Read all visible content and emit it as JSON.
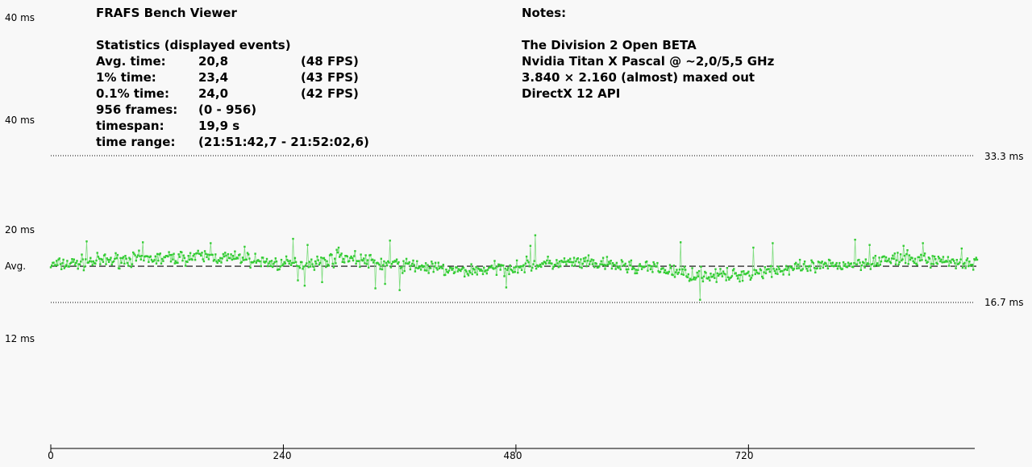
{
  "header": {
    "title": "FRAFS Bench Viewer",
    "stats_heading": "Statistics (displayed events)",
    "rows": [
      {
        "label": "Avg. time:",
        "value": "20,8",
        "extra": "(48 FPS)"
      },
      {
        "label": "1% time:",
        "value": "23,4",
        "extra": "(43 FPS)"
      },
      {
        "label": "0.1% time:",
        "value": "24,0",
        "extra": "(42 FPS)"
      },
      {
        "label": "956 frames:",
        "value": "(0 - 956)",
        "extra": ""
      },
      {
        "label": "timespan:",
        "value": "19,9 s",
        "extra": ""
      },
      {
        "label": "time range:",
        "value": "(21:51:42,7 - 21:52:02,6)",
        "extra": ""
      }
    ]
  },
  "notes": {
    "heading": "Notes:",
    "lines": [
      "The Division 2 Open BETA",
      "Nvidia Titan X Pascal @ ~2,0/5,5 GHz",
      "3.840 × 2.160 (almost) maxed out",
      "DirectX 12 API"
    ]
  },
  "axis_left": {
    "top": "40 ms",
    "upper": "40 ms",
    "mid": "20 ms",
    "avg": "Avg.",
    "low": "12 ms"
  },
  "axis_right": {
    "upper": "33.3 ms",
    "lower": "16.7 ms"
  },
  "x_ticks": [
    "0",
    "240",
    "480",
    "720"
  ],
  "colors": {
    "series": "#33cc33",
    "series_dark": "#22aa22",
    "line": "#000000"
  },
  "chart_data": {
    "type": "scatter",
    "title": "FRAFS Bench Viewer",
    "xlabel": "",
    "ylabel": "",
    "x_range": [
      0,
      956
    ],
    "x_ticks": [
      0,
      240,
      480,
      720
    ],
    "reference_lines": [
      {
        "label": "33.3 ms",
        "value": 33.3,
        "style": "dotted"
      },
      {
        "label": "Avg.",
        "value": 20.8,
        "style": "dashed"
      },
      {
        "label": "16.7 ms",
        "value": 16.7,
        "style": "dotted"
      }
    ],
    "y_tick_labels": [
      "40 ms",
      "40 ms",
      "20 ms",
      "12 ms"
    ],
    "series": [
      {
        "values_profile": [
          [
            0,
            20.9
          ],
          [
            40,
            21.3
          ],
          [
            80,
            21.6
          ],
          [
            120,
            21.7
          ],
          [
            160,
            21.9
          ],
          [
            200,
            21.6
          ],
          [
            240,
            21.0
          ],
          [
            280,
            21.3
          ],
          [
            300,
            21.9
          ],
          [
            340,
            21.1
          ],
          [
            380,
            20.8
          ],
          [
            420,
            20.2
          ],
          [
            460,
            20.5
          ],
          [
            500,
            21.0
          ],
          [
            540,
            21.2
          ],
          [
            580,
            20.9
          ],
          [
            620,
            20.6
          ],
          [
            660,
            19.9
          ],
          [
            700,
            19.7
          ],
          [
            740,
            20.3
          ],
          [
            780,
            20.6
          ],
          [
            820,
            21.0
          ],
          [
            860,
            21.5
          ],
          [
            900,
            21.6
          ],
          [
            956,
            21.1
          ]
        ],
        "spikes": [
          [
            37,
            23.6
          ],
          [
            95,
            23.5
          ],
          [
            165,
            23.4
          ],
          [
            250,
            23.9
          ],
          [
            265,
            23.2
          ],
          [
            262,
            18.6
          ],
          [
            255,
            19.2
          ],
          [
            297,
            22.9
          ],
          [
            350,
            23.7
          ],
          [
            345,
            18.8
          ],
          [
            500,
            24.3
          ],
          [
            495,
            23.1
          ],
          [
            470,
            18.4
          ],
          [
            335,
            18.3
          ],
          [
            360,
            18.1
          ],
          [
            650,
            23.5
          ],
          [
            670,
            17.0
          ],
          [
            605,
            20.0
          ],
          [
            725,
            22.9
          ],
          [
            745,
            23.4
          ],
          [
            830,
            23.8
          ],
          [
            845,
            23.2
          ],
          [
            880,
            23.1
          ],
          [
            900,
            23.4
          ],
          [
            940,
            22.8
          ],
          [
            200,
            23.0
          ],
          [
            280,
            19.0
          ]
        ],
        "noise_ms": 0.55
      }
    ]
  }
}
